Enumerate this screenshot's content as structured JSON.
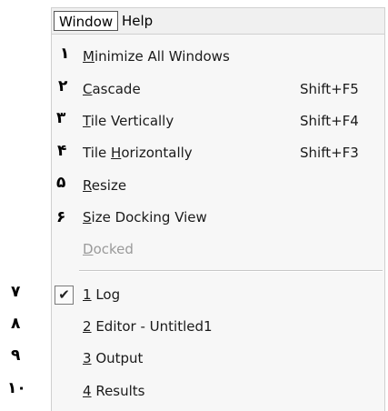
{
  "menubar": {
    "menus": [
      {
        "label": "Window",
        "active": true
      },
      {
        "label": "Help",
        "active": false
      }
    ]
  },
  "menu_items": [
    {
      "label": "Minimize All Windows",
      "mnemonic": "M",
      "shortcut": "",
      "disabled": false,
      "checked": false,
      "annotation": "١"
    },
    {
      "label": "Cascade",
      "mnemonic": "C",
      "shortcut": "Shift+F5",
      "disabled": false,
      "checked": false,
      "annotation": "٢"
    },
    {
      "label": "Tile Vertically",
      "mnemonic": "T",
      "shortcut": "Shift+F4",
      "disabled": false,
      "checked": false,
      "annotation": "٣"
    },
    {
      "label": "Tile Horizontally",
      "mnemonic": "H",
      "shortcut": "Shift+F3",
      "disabled": false,
      "checked": false,
      "annotation": "۴"
    },
    {
      "label": "Resize",
      "mnemonic": "R",
      "shortcut": "",
      "disabled": false,
      "checked": false,
      "annotation": "۵"
    },
    {
      "label": "Size Docking View",
      "mnemonic": "S",
      "shortcut": "",
      "disabled": false,
      "checked": false,
      "annotation": "۶"
    },
    {
      "label": "Docked",
      "mnemonic": "D",
      "shortcut": "",
      "disabled": true,
      "checked": false,
      "annotation": ""
    }
  ],
  "window_list": [
    {
      "label": "1 Log",
      "mnemonic": "1",
      "checked": true,
      "check_glyph": "✔",
      "annotation": "٧"
    },
    {
      "label": "2 Editor - Untitled1",
      "mnemonic": "2",
      "checked": false,
      "annotation": "٨"
    },
    {
      "label": "3 Output",
      "mnemonic": "3",
      "checked": false,
      "annotation": "٩"
    },
    {
      "label": "4 Results",
      "mnemonic": "4",
      "checked": false,
      "annotation": "١٠"
    }
  ]
}
